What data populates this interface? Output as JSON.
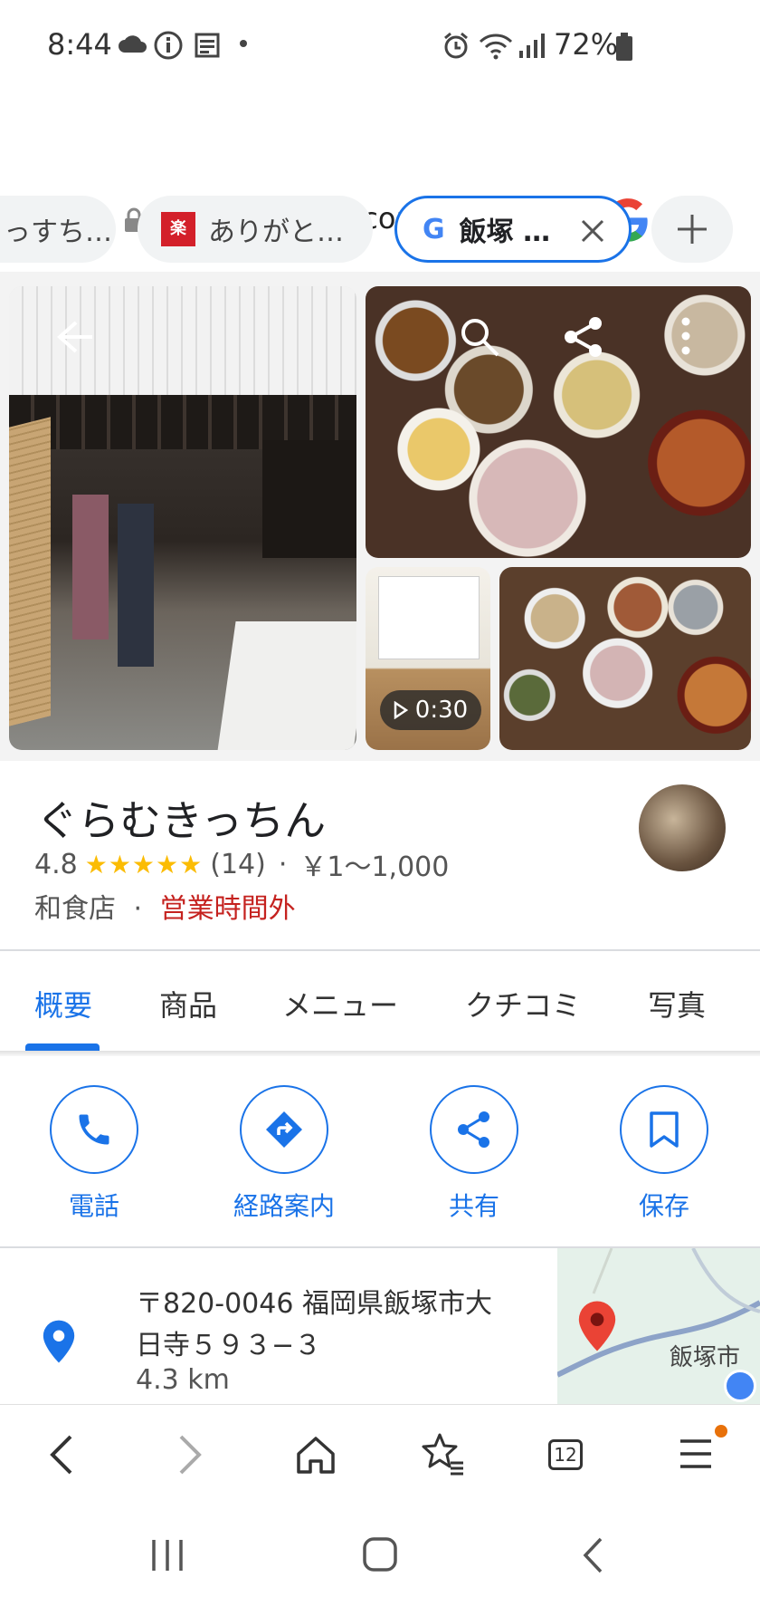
{
  "status_bar": {
    "time": "8:44",
    "battery": "72%"
  },
  "browser": {
    "url": "www.google.com/search?q=",
    "tabs": [
      {
        "label": "っすち…"
      },
      {
        "label": "ありがと…"
      },
      {
        "label": "飯塚 …"
      }
    ]
  },
  "media": {
    "video_duration": "0:30"
  },
  "place": {
    "name": "ぐらむきっちん",
    "rating": "4.8",
    "stars": "★★★★★",
    "review_count": "(14)",
    "price": "￥1〜1,000",
    "category": "和食店",
    "hours_status": "営業時間外",
    "separator": "·"
  },
  "place_tabs": [
    "概要",
    "商品",
    "メニュー",
    "クチコミ",
    "写真"
  ],
  "actions": [
    {
      "label": "電話",
      "icon": "phone-icon"
    },
    {
      "label": "経路案内",
      "icon": "directions-icon"
    },
    {
      "label": "共有",
      "icon": "share-icon"
    },
    {
      "label": "保存",
      "icon": "bookmark-icon"
    }
  ],
  "address": {
    "line1": "〒820-0046 福岡県飯塚市大",
    "line2": "日寺５９３−３",
    "distance": "4.3 km",
    "map_label": "飯塚市"
  },
  "bottom_nav": {
    "tab_count": "12"
  },
  "colors": {
    "accent": "#1a73e8",
    "closed": "#c5221f",
    "star": "#fbbc04"
  }
}
